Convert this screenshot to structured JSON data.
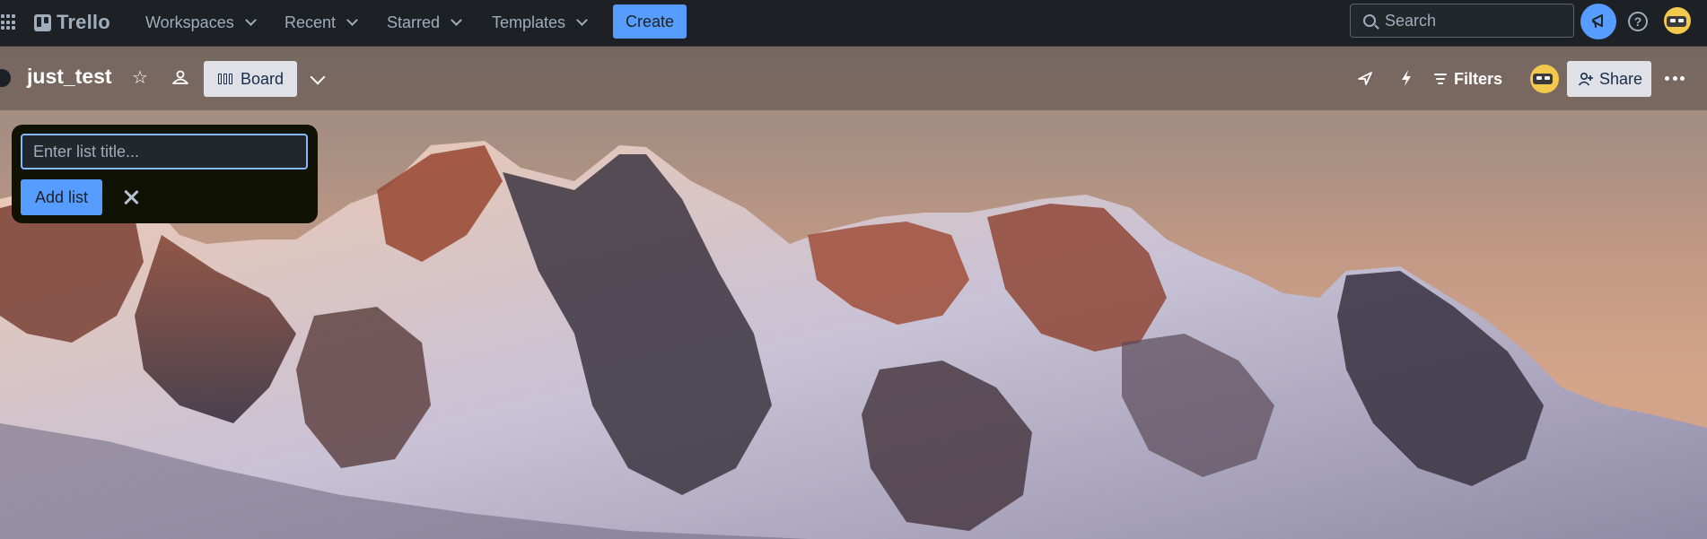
{
  "topnav": {
    "logo_text": "Trello",
    "menus": [
      {
        "label": "Workspaces"
      },
      {
        "label": "Recent"
      },
      {
        "label": "Starred"
      },
      {
        "label": "Templates"
      }
    ],
    "create_label": "Create",
    "search_placeholder": "Search",
    "icons": [
      "apps-grid-icon",
      "notifications-icon",
      "help-icon",
      "user-avatar"
    ]
  },
  "board": {
    "title": "just_test",
    "view_label": "Board",
    "filters_label": "Filters",
    "share_label": "Share",
    "header_icons": [
      "star-icon",
      "visibility-icon",
      "view-switcher-chevron-icon",
      "power-ups-icon",
      "automation-icon",
      "filter-icon",
      "more-icon"
    ]
  },
  "add_list": {
    "placeholder": "Enter list title...",
    "button_label": "Add list"
  },
  "colors": {
    "accent": "#579dff",
    "nav_bg": "#1d2125",
    "popup_bg": "#101204",
    "input_focus": "#85b8ff"
  }
}
